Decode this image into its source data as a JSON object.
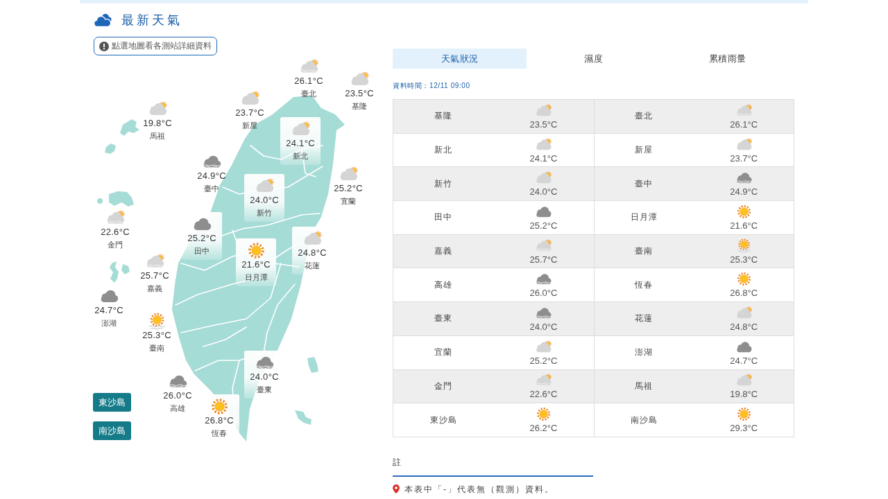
{
  "header": {
    "title": "最新天氣"
  },
  "map": {
    "hint_button": "點選地圖看各測站詳細資料",
    "stations": [
      {
        "name": "臺北",
        "temperature": "26.1°C",
        "kind": "partly_cloudy_fog"
      },
      {
        "name": "基隆",
        "temperature": "23.5°C",
        "kind": "partly_cloudy"
      },
      {
        "name": "新屋",
        "temperature": "23.7°C",
        "kind": "partly_cloudy"
      },
      {
        "name": "馬祖",
        "temperature": "19.8°C",
        "kind": "partly_cloudy"
      },
      {
        "name": "新北",
        "temperature": "24.1°C",
        "kind": "partly_cloudy"
      },
      {
        "name": "臺中",
        "temperature": "24.9°C",
        "kind": "cloudy_fog"
      },
      {
        "name": "宜蘭",
        "temperature": "25.2°C",
        "kind": "partly_cloudy"
      },
      {
        "name": "新竹",
        "temperature": "24.0°C",
        "kind": "partly_cloudy"
      },
      {
        "name": "金門",
        "temperature": "22.6°C",
        "kind": "partly_cloudy_fog"
      },
      {
        "name": "田中",
        "temperature": "25.2°C",
        "kind": "cloudy"
      },
      {
        "name": "花蓮",
        "temperature": "24.8°C",
        "kind": "partly_cloudy"
      },
      {
        "name": "日月潭",
        "temperature": "21.6°C",
        "kind": "sunny"
      },
      {
        "name": "嘉義",
        "temperature": "25.7°C",
        "kind": "partly_cloudy_fog"
      },
      {
        "name": "澎湖",
        "temperature": "24.7°C",
        "kind": "cloudy"
      },
      {
        "name": "臺南",
        "temperature": "25.3°C",
        "kind": "sunny_fog"
      },
      {
        "name": "臺東",
        "temperature": "24.0°C",
        "kind": "cloudy_fog"
      },
      {
        "name": "高雄",
        "temperature": "26.0°C",
        "kind": "cloudy_fog"
      },
      {
        "name": "恆春",
        "temperature": "26.8°C",
        "kind": "sunny"
      }
    ],
    "area_buttons": [
      "東沙島",
      "南沙島"
    ]
  },
  "tabs": [
    {
      "label": "天氣狀況",
      "selected": true
    },
    {
      "label": "濕度",
      "selected": false
    },
    {
      "label": "累積雨量",
      "selected": false
    }
  ],
  "data_time": "資料時間：12/11 09:00",
  "table": {
    "rows": [
      {
        "cells": [
          {
            "station": "基隆",
            "kind": "partly_cloudy",
            "temperature": "23.5°C"
          },
          {
            "station": "臺北",
            "kind": "partly_cloudy_fog",
            "temperature": "26.1°C"
          }
        ]
      },
      {
        "cells": [
          {
            "station": "新北",
            "kind": "partly_cloudy",
            "temperature": "24.1°C"
          },
          {
            "station": "新屋",
            "kind": "partly_cloudy",
            "temperature": "23.7°C"
          }
        ]
      },
      {
        "cells": [
          {
            "station": "新竹",
            "kind": "partly_cloudy",
            "temperature": "24.0°C"
          },
          {
            "station": "臺中",
            "kind": "cloudy_fog",
            "temperature": "24.9°C"
          }
        ]
      },
      {
        "cells": [
          {
            "station": "田中",
            "kind": "cloudy",
            "temperature": "25.2°C"
          },
          {
            "station": "日月潭",
            "kind": "sunny",
            "temperature": "21.6°C"
          }
        ]
      },
      {
        "cells": [
          {
            "station": "嘉義",
            "kind": "partly_cloudy_fog",
            "temperature": "25.7°C"
          },
          {
            "station": "臺南",
            "kind": "sunny_fog",
            "temperature": "25.3°C"
          }
        ]
      },
      {
        "cells": [
          {
            "station": "高雄",
            "kind": "cloudy_fog",
            "temperature": "26.0°C"
          },
          {
            "station": "恆春",
            "kind": "sunny",
            "temperature": "26.8°C"
          }
        ]
      },
      {
        "cells": [
          {
            "station": "臺東",
            "kind": "cloudy_fog",
            "temperature": "24.0°C"
          },
          {
            "station": "花蓮",
            "kind": "partly_cloudy",
            "temperature": "24.8°C"
          }
        ]
      },
      {
        "cells": [
          {
            "station": "宜蘭",
            "kind": "partly_cloudy",
            "temperature": "25.2°C"
          },
          {
            "station": "澎湖",
            "kind": "cloudy",
            "temperature": "24.7°C"
          }
        ]
      },
      {
        "cells": [
          {
            "station": "金門",
            "kind": "partly_cloudy_fog",
            "temperature": "22.6°C"
          },
          {
            "station": "馬祖",
            "kind": "partly_cloudy",
            "temperature": "19.8°C"
          }
        ]
      },
      {
        "cells": [
          {
            "station": "東沙島",
            "kind": "sunny",
            "temperature": "26.2°C"
          },
          {
            "station": "南沙島",
            "kind": "sunny",
            "temperature": "29.3°C"
          }
        ]
      }
    ]
  },
  "note": {
    "heading": "註",
    "items": [
      "本表中「-」代表無（觀測）資料。"
    ]
  }
}
